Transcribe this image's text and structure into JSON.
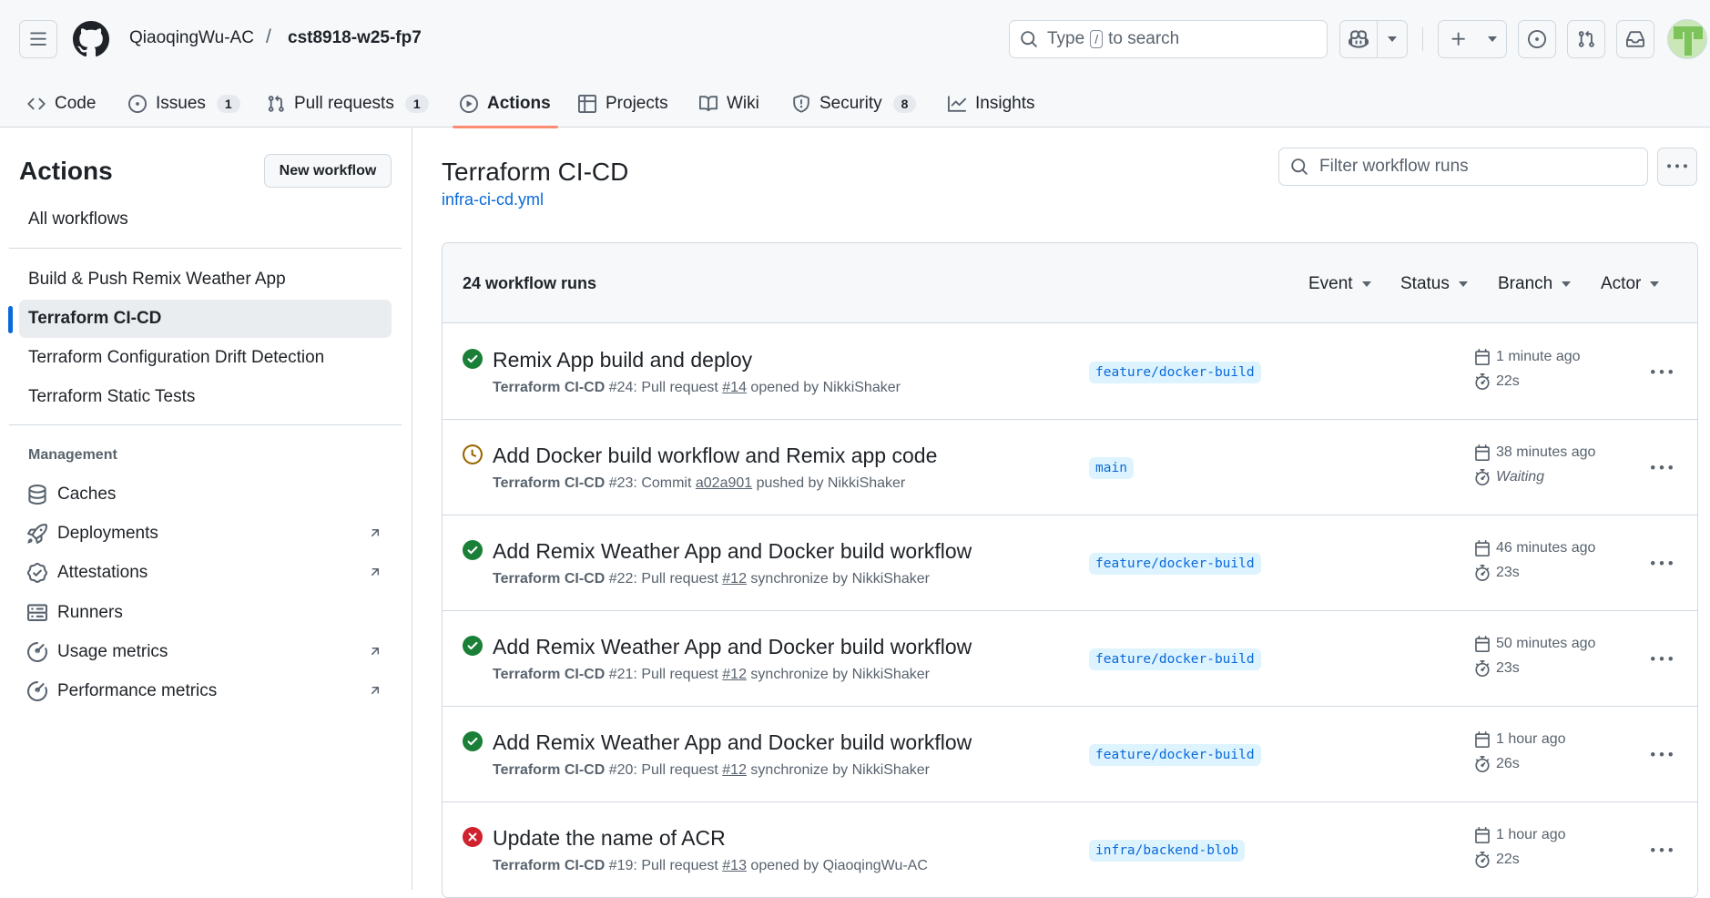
{
  "header": {
    "owner": "QiaoqingWu-AC",
    "separator": "/",
    "repo": "cst8918-w25-fp7",
    "search_prefix": "Type",
    "search_key": "/",
    "search_suffix": "to search"
  },
  "nav": {
    "tabs": [
      {
        "label": "Code",
        "icon": "code-icon"
      },
      {
        "label": "Issues",
        "icon": "issue-icon",
        "count": "1"
      },
      {
        "label": "Pull requests",
        "icon": "pull-request-icon",
        "count": "1"
      },
      {
        "label": "Actions",
        "icon": "play-icon",
        "active": true
      },
      {
        "label": "Projects",
        "icon": "table-icon"
      },
      {
        "label": "Wiki",
        "icon": "book-icon"
      },
      {
        "label": "Security",
        "icon": "shield-icon",
        "count": "8"
      },
      {
        "label": "Insights",
        "icon": "graph-icon"
      }
    ]
  },
  "sidebar": {
    "title": "Actions",
    "new_workflow": "New workflow",
    "all_workflows": "All workflows",
    "workflows": [
      "Build & Push Remix Weather App",
      "Terraform CI-CD",
      "Terraform Configuration Drift Detection",
      "Terraform Static Tests"
    ],
    "management_heading": "Management",
    "management": [
      {
        "label": "Caches",
        "icon": "database-icon"
      },
      {
        "label": "Deployments",
        "icon": "rocket-icon",
        "external": true
      },
      {
        "label": "Attestations",
        "icon": "verified-icon",
        "external": true
      },
      {
        "label": "Runners",
        "icon": "server-icon"
      },
      {
        "label": "Usage metrics",
        "icon": "meter-icon",
        "external": true
      },
      {
        "label": "Performance metrics",
        "icon": "meter-icon",
        "external": true
      }
    ]
  },
  "main": {
    "title": "Terraform CI-CD",
    "file": "infra-ci-cd.yml",
    "filter_placeholder": "Filter workflow runs",
    "runs_count": "24 workflow runs",
    "filters": [
      "Event",
      "Status",
      "Branch",
      "Actor"
    ],
    "runs": [
      {
        "status": "success",
        "title": "Remix App build and deploy",
        "workflow": "Terraform CI-CD",
        "meta_a": "#24: Pull request ",
        "ref": "#14",
        "meta_b": " opened by NikkiShaker",
        "branch": "feature/docker-build",
        "time": "1 minute ago",
        "duration": "22s"
      },
      {
        "status": "queued",
        "title": "Add Docker build workflow and Remix app code",
        "workflow": "Terraform CI-CD",
        "meta_a": "#23: Commit ",
        "ref": "a02a901",
        "meta_b": " pushed by NikkiShaker",
        "branch": "main",
        "time": "38 minutes ago",
        "duration": "Waiting"
      },
      {
        "status": "success",
        "title": "Add Remix Weather App and Docker build workflow",
        "workflow": "Terraform CI-CD",
        "meta_a": "#22: Pull request ",
        "ref": "#12",
        "meta_b": " synchronize by NikkiShaker",
        "branch": "feature/docker-build",
        "time": "46 minutes ago",
        "duration": "23s"
      },
      {
        "status": "success",
        "title": "Add Remix Weather App and Docker build workflow",
        "workflow": "Terraform CI-CD",
        "meta_a": "#21: Pull request ",
        "ref": "#12",
        "meta_b": " synchronize by NikkiShaker",
        "branch": "feature/docker-build",
        "time": "50 minutes ago",
        "duration": "23s"
      },
      {
        "status": "success",
        "title": "Add Remix Weather App and Docker build workflow",
        "workflow": "Terraform CI-CD",
        "meta_a": "#20: Pull request ",
        "ref": "#12",
        "meta_b": " synchronize by NikkiShaker",
        "branch": "feature/docker-build",
        "time": "1 hour ago",
        "duration": "26s"
      },
      {
        "status": "failure",
        "title": "Update the name of ACR",
        "workflow": "Terraform CI-CD",
        "meta_a": "#19: Pull request ",
        "ref": "#13",
        "meta_b": " opened by QiaoqingWu-AC",
        "branch": "infra/backend-blob",
        "time": "1 hour ago",
        "duration": "22s"
      }
    ]
  },
  "colors": {
    "success": "#1a7f37",
    "queued": "#9a6700",
    "failure": "#cf222e",
    "link": "#0969da",
    "active_tab_underline": "#fd8c73"
  }
}
